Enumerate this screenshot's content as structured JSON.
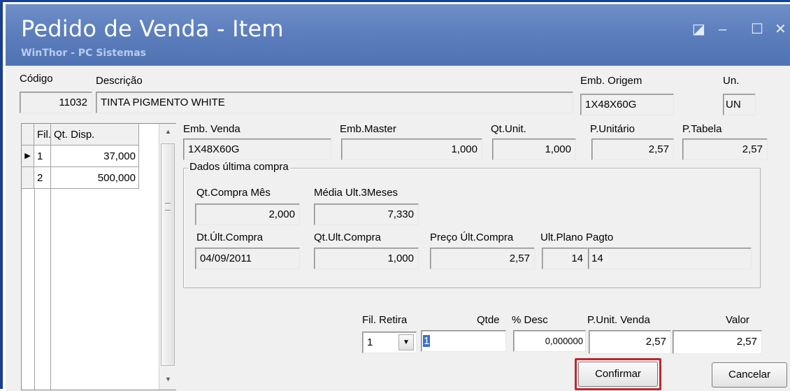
{
  "window": {
    "title": "Pedido de Venda - Item",
    "subtitle": "WinThor - PC Sistemas",
    "controls": {
      "restore": "◪",
      "minimize": "–",
      "maximize": "☐",
      "close": "✕"
    }
  },
  "header": {
    "codigo_label": "Código",
    "codigo_value": "11032",
    "descricao_label": "Descrição",
    "descricao_value": "TINTA PIGMENTO WHITE",
    "emb_origem_label": "Emb. Origem",
    "emb_origem_value": "1X48X60G",
    "un_label": "Un.",
    "un_value": "UN"
  },
  "stock_grid": {
    "columns": [
      "Fil.",
      "Qt. Disp."
    ],
    "rows": [
      {
        "fil": "1",
        "qt": "37,000",
        "selected": true
      },
      {
        "fil": "2",
        "qt": "500,000",
        "selected": false
      }
    ]
  },
  "packaging": {
    "emb_venda_label": "Emb. Venda",
    "emb_venda_value": "1X48X60G",
    "emb_master_label": "Emb.Master",
    "emb_master_value": "1,000",
    "qt_unit_label": "Qt.Unit.",
    "qt_unit_value": "1,000",
    "p_unitario_label": "P.Unitário",
    "p_unitario_value": "2,57",
    "p_tabela_label": "P.Tabela",
    "p_tabela_value": "2,57"
  },
  "last_purchase": {
    "group_label": "Dados última compra",
    "qt_compra_mes_label": "Qt.Compra Mês",
    "qt_compra_mes_value": "2,000",
    "media_label": "Média Ult.3Meses",
    "media_value": "7,330",
    "dt_label": "Dt.Últ.Compra",
    "dt_value": "04/09/2011",
    "qt_ult_label": "Qt.Ult.Compra",
    "qt_ult_value": "1,000",
    "preco_label": "Preço Últ.Compra",
    "preco_value": "2,57",
    "plano_label": "Ult.Plano Pagto",
    "plano_code": "14",
    "plano_desc": "14"
  },
  "order": {
    "fil_retira_label": "Fil. Retira",
    "fil_retira_value": "1",
    "qtde_label": "Qtde",
    "qtde_value": "1",
    "desc_label": "% Desc",
    "desc_value": "0,000000",
    "p_unit_venda_label": "P.Unit. Venda",
    "p_unit_venda_value": "2,57",
    "valor_label": "Valor",
    "valor_value": "2,57"
  },
  "buttons": {
    "confirmar": "Confirmar",
    "cancelar": "Cancelar"
  }
}
